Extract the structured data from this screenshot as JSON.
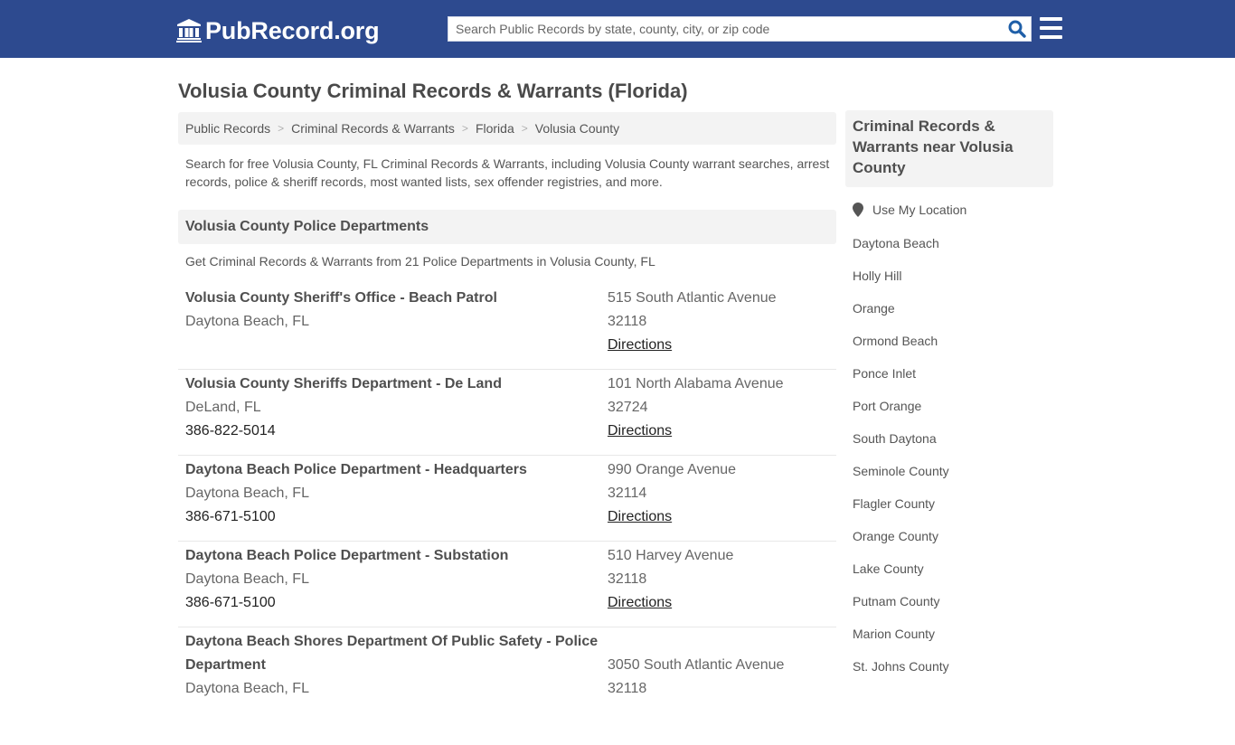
{
  "header": {
    "logo_text": "PubRecord.org",
    "search_placeholder": "Search Public Records by state, county, city, or zip code",
    "search_value": "",
    "brand_color": "#2d4a8f",
    "search_icon_color": "#1f5fa8"
  },
  "page": {
    "title": "Volusia County Criminal Records & Warrants (Florida)",
    "breadcrumb": [
      {
        "label": "Public Records"
      },
      {
        "label": "Criminal Records & Warrants"
      },
      {
        "label": "Florida"
      },
      {
        "label": "Volusia County"
      }
    ],
    "breadcrumb_separator": ">",
    "intro": "Search for free Volusia County, FL Criminal Records & Warrants, including Volusia County warrant searches, arrest records, police & sheriff records, most wanted lists, sex offender registries, and more."
  },
  "police": {
    "heading": "Volusia County Police Departments",
    "subtitle": "Get Criminal Records & Warrants from 21 Police Departments in Volusia County, FL",
    "directions_label": "Directions",
    "departments": [
      {
        "name": "Volusia County Sheriff's Office - Beach Patrol",
        "city": "Daytona Beach, FL",
        "phone": "",
        "address": "515 South Atlantic Avenue",
        "zip": "32118"
      },
      {
        "name": "Volusia County Sheriffs Department - De Land",
        "city": "DeLand, FL",
        "phone": "386-822-5014",
        "address": "101 North Alabama Avenue",
        "zip": "32724"
      },
      {
        "name": "Daytona Beach Police Department - Headquarters",
        "city": "Daytona Beach, FL",
        "phone": "386-671-5100",
        "address": "990 Orange Avenue",
        "zip": "32114"
      },
      {
        "name": "Daytona Beach Police Department - Substation",
        "city": "Daytona Beach, FL",
        "phone": "386-671-5100",
        "address": "510 Harvey Avenue",
        "zip": "32118"
      },
      {
        "name": "Daytona Beach Shores Department Of Public Safety - Police Department",
        "city": "Daytona Beach, FL",
        "phone": "",
        "address": "3050 South Atlantic Avenue",
        "zip": "32118"
      }
    ]
  },
  "sidebar": {
    "heading": "Criminal Records & Warrants near Volusia County",
    "use_location_label": "Use My Location",
    "links": [
      "Daytona Beach",
      "Holly Hill",
      "Orange",
      "Ormond Beach",
      "Ponce Inlet",
      "Port Orange",
      "South Daytona",
      "Seminole County",
      "Flagler County",
      "Orange County",
      "Lake County",
      "Putnam County",
      "Marion County",
      "St. Johns County"
    ]
  }
}
